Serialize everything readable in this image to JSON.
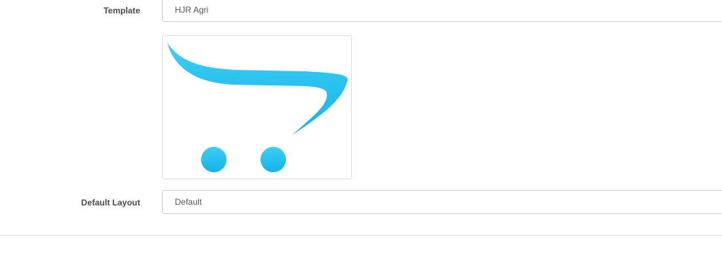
{
  "form": {
    "template": {
      "label": "Template",
      "value": "HJR Agri"
    },
    "preview": {
      "icon": "opencart-cart-logo-icon",
      "accent_color": "#29c2ef"
    },
    "default_layout": {
      "label": "Default Layout",
      "value": "Default"
    }
  }
}
